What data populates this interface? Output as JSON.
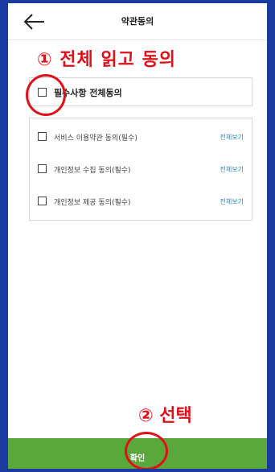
{
  "header": {
    "title": "약관동의",
    "back_icon": "arrow-left-icon"
  },
  "annotations": {
    "step1": "① 전체 읽고 동의",
    "step2": "② 선택",
    "color": "#e0101a"
  },
  "agree_all": {
    "label": "필수사항 전체동의",
    "checked": false
  },
  "terms": [
    {
      "label": "서비스 이용약관 동의(필수)",
      "link": "전체보기",
      "checked": false
    },
    {
      "label": "개인정보 수집 동의(필수)",
      "link": "전체보기",
      "checked": false
    },
    {
      "label": "개인정보 제공 동의(필수)",
      "link": "전체보기",
      "checked": false
    }
  ],
  "confirm": {
    "label": "확인",
    "color": "#5aa83c"
  },
  "colors": {
    "frame": "#1a3aa0",
    "link": "#1a8fc9"
  }
}
